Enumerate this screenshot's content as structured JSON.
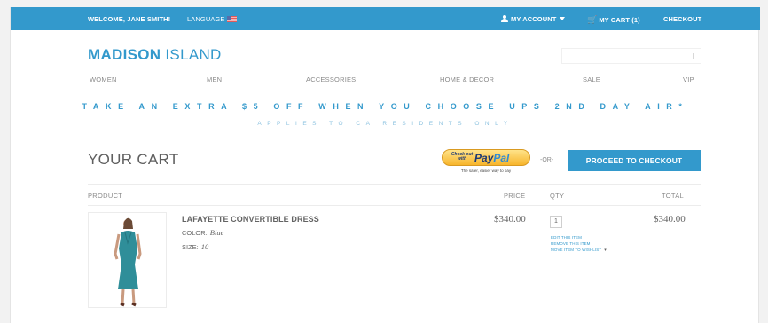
{
  "topbar": {
    "welcome": "WELCOME, JANE SMITH!",
    "language": "LANGUAGE",
    "my_account": "MY ACCOUNT",
    "my_cart": "MY CART (1)",
    "checkout": "CHECKOUT"
  },
  "header": {
    "logo_bold": "MADISON",
    "logo_light": " ISLAND"
  },
  "nav": {
    "items": [
      "WOMEN",
      "MEN",
      "ACCESSORIES",
      "HOME & DECOR",
      "SALE",
      "VIP"
    ]
  },
  "promo": {
    "line1": "TAKE AN EXTRA $5 OFF WHEN YOU CHOOSE UPS 2ND DAY AIR*",
    "line2": "APPLIES TO CA RESIDENTS ONLY"
  },
  "cart": {
    "title": "YOUR CART",
    "paypal": {
      "small": "Check out with",
      "logo_a": "Pay",
      "logo_b": "Pal",
      "tagline": "The safer, easier way to pay"
    },
    "or": "-OR-",
    "proceed": "PROCEED TO CHECKOUT",
    "headers": {
      "product": "PRODUCT",
      "price": "PRICE",
      "qty": "QTY",
      "total": "TOTAL"
    },
    "item": {
      "name": "LAFAYETTE CONVERTIBLE DRESS",
      "color_label": "COLOR:",
      "color_value": "Blue",
      "size_label": "SIZE:",
      "size_value": "10",
      "price": "$340.00",
      "qty": "1",
      "total": "$340.00",
      "edit_link": "EDIT THIS ITEM",
      "remove_link": "REMOVE THIS ITEM",
      "wishlist_link": "MOVE ITEM TO WISHLIST"
    }
  },
  "colors": {
    "accent": "#3399cc",
    "text": "#636363"
  }
}
